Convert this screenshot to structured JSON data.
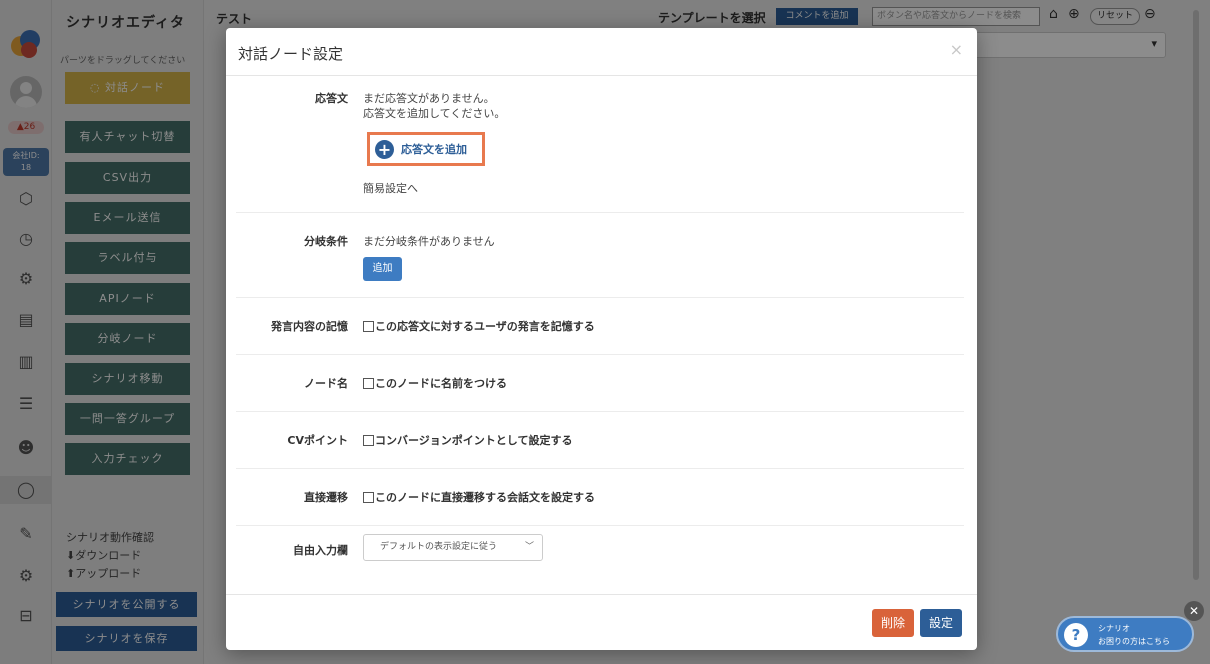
{
  "sidebar": {
    "notification_count": "26",
    "company_label": "会社ID:",
    "company_id": "18"
  },
  "panel": {
    "title": "シナリオエディタ",
    "hint": "パーツをドラッグしてください",
    "dialog_node": "対話ノード",
    "buttons": [
      "有人チャット切替",
      "CSV出力",
      "Eメール送信",
      "ラベル付与",
      "APIノード",
      "分岐ノード",
      "シナリオ移動",
      "一問一答グループ",
      "入力チェック"
    ],
    "links": [
      "シナリオ動作確認",
      "ダウンロード",
      "アップロード"
    ],
    "publish": "シナリオを公開する",
    "save": "シナリオを保存"
  },
  "topbar": {
    "title": "テスト",
    "template": "テンプレートを選択",
    "add_comment": "コメントを追加",
    "search_placeholder": "ボタン名や応答文からノードを検索",
    "reset": "リセット"
  },
  "modal": {
    "title": "対話ノード設定",
    "close": "×",
    "response": {
      "label": "応答文",
      "empty1": "まだ応答文がありません。",
      "empty2": "応答文を追加してください。",
      "add": "応答文を追加",
      "simple": "簡易設定へ"
    },
    "branch": {
      "label": "分岐条件",
      "empty": "まだ分岐条件がありません",
      "add": "追加"
    },
    "memory": {
      "label": "発言内容の記憶",
      "checkbox": "この応答文に対するユーザの発言を記憶する"
    },
    "node_name": {
      "label": "ノード名",
      "checkbox": "このノードに名前をつける"
    },
    "cv_point": {
      "label": "CVポイント",
      "checkbox": "コンバージョンポイントとして設定する"
    },
    "direct": {
      "label": "直接遷移",
      "checkbox": "このノードに直接遷移する会話文を設定する"
    },
    "free_input": {
      "label": "自由入力欄",
      "selected": "デフォルトの表示設定に従う"
    },
    "delete": "削除",
    "submit": "設定"
  },
  "help": {
    "line1": "シナリオ",
    "line2": "お困りの方はこちら"
  },
  "colors": {
    "primary": "#2d5e97",
    "danger": "#d9633a",
    "highlight": "#e8794e",
    "panel_button": "#46706a",
    "gold": "#d5b449"
  }
}
